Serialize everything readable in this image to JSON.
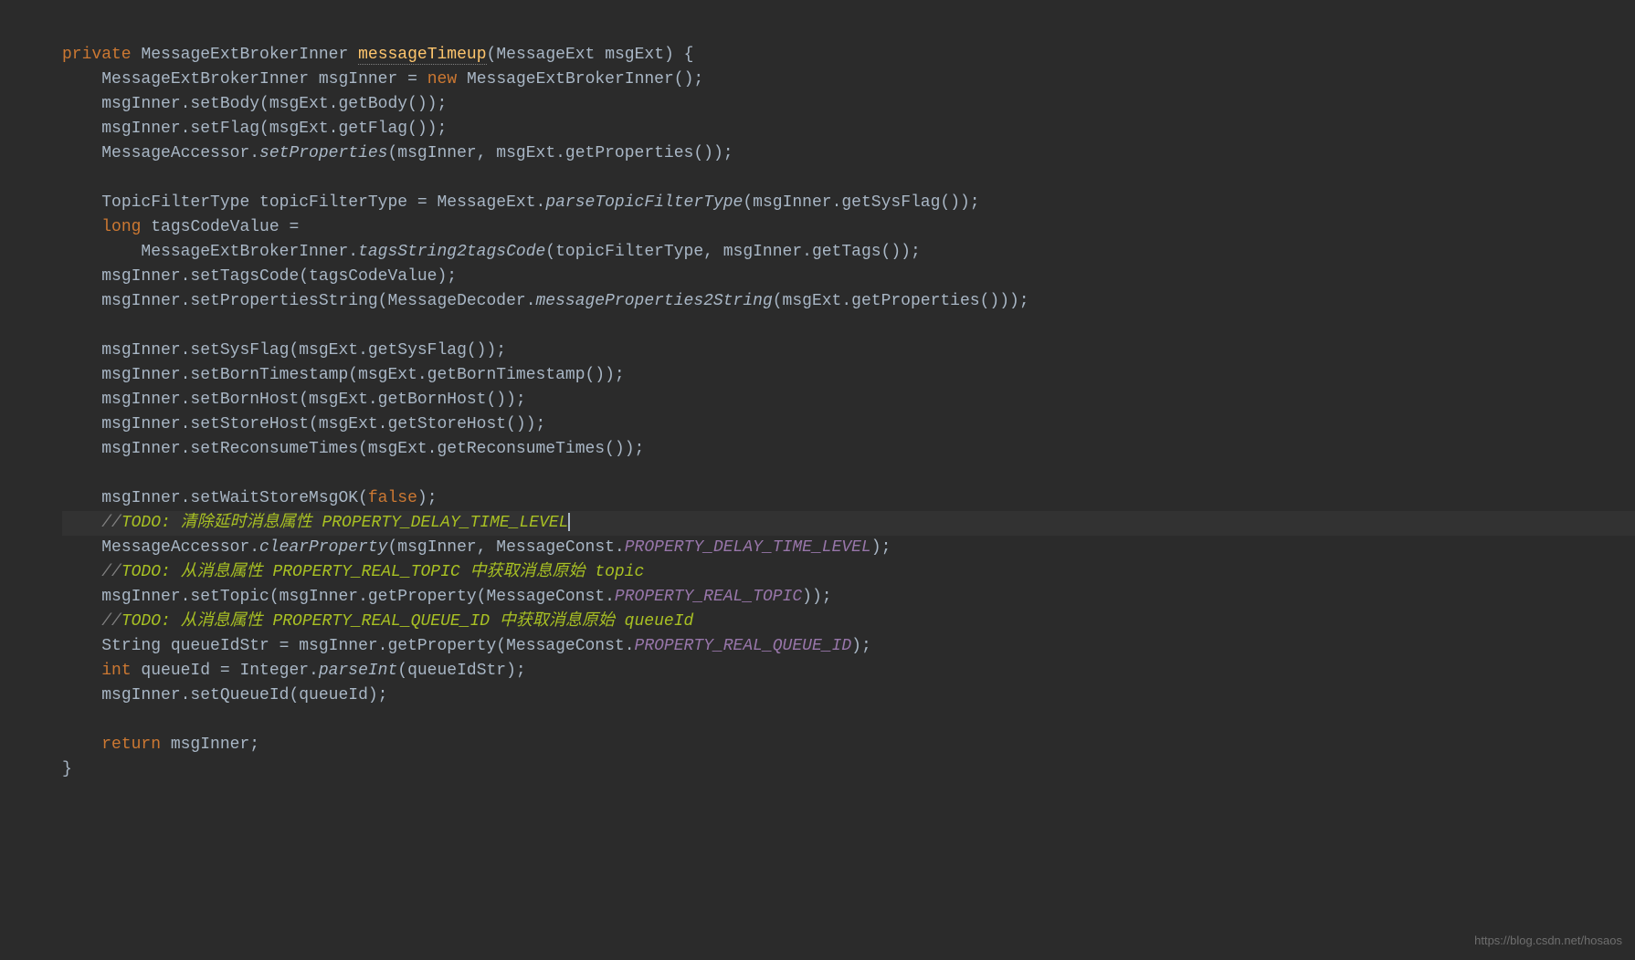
{
  "code": {
    "modifier_private": "private",
    "return_type": "MessageExtBrokerInner",
    "method_name": "messageTimeup",
    "param_type": "MessageExt",
    "param_name": "msgExt",
    "brace_open": "{",
    "brace_close": "}",
    "l1_type": "MessageExtBrokerInner",
    "l1_var": "msgInner",
    "l1_eq": "=",
    "l1_new": "new",
    "l1_ctor": "MessageExtBrokerInner();",
    "l2": "msgInner.setBody(msgExt.getBody());",
    "l3": "msgInner.setFlag(msgExt.getFlag());",
    "l4_a": "MessageAccessor.",
    "l4_m": "setProperties",
    "l4_b": "(msgInner, msgExt.getProperties());",
    "l5_a": "TopicFilterType topicFilterType = MessageExt.",
    "l5_m": "parseTopicFilterType",
    "l5_b": "(msgInner.getSysFlag());",
    "l6_kw": "long",
    "l6_a": " tagsCodeValue =",
    "l7_a": "MessageExtBrokerInner.",
    "l7_m": "tagsString2tagsCode",
    "l7_b": "(topicFilterType, msgInner.getTags());",
    "l8": "msgInner.setTagsCode(tagsCodeValue);",
    "l9_a": "msgInner.setPropertiesString(MessageDecoder.",
    "l9_m": "messageProperties2String",
    "l9_b": "(msgExt.getProperties()));",
    "l10": "msgInner.setSysFlag(msgExt.getSysFlag());",
    "l11": "msgInner.setBornTimestamp(msgExt.getBornTimestamp());",
    "l12": "msgInner.setBornHost(msgExt.getBornHost());",
    "l13": "msgInner.setStoreHost(msgExt.getStoreHost());",
    "l14": "msgInner.setReconsumeTimes(msgExt.getReconsumeTimes());",
    "l15_a": "msgInner.setWaitStoreMsgOK(",
    "l15_false": "false",
    "l15_b": ");",
    "c1_slash": "//",
    "c1_todo": "TODO: 清除延时消息属性 PROPERTY_DELAY_TIME_LEVEL",
    "l16_a": "MessageAccessor.",
    "l16_m": "clearProperty",
    "l16_b": "(msgInner, MessageConst.",
    "l16_const": "PROPERTY_DELAY_TIME_LEVEL",
    "l16_c": ");",
    "c2_slash": "//",
    "c2_todo": "TODO: 从消息属性 PROPERTY_REAL_TOPIC 中获取消息原始 topic",
    "l17_a": "msgInner.setTopic(msgInner.getProperty(MessageConst.",
    "l17_const": "PROPERTY_REAL_TOPIC",
    "l17_b": "));",
    "c3_slash": "//",
    "c3_todo": "TODO: 从消息属性 PROPERTY_REAL_QUEUE_ID 中获取消息原始 queueId",
    "l18_a": "String queueIdStr = msgInner.getProperty(MessageConst.",
    "l18_const": "PROPERTY_REAL_QUEUE_ID",
    "l18_b": ");",
    "l19_kw": "int",
    "l19_a": " queueId = Integer.",
    "l19_m": "parseInt",
    "l19_b": "(queueIdStr);",
    "l20": "msgInner.setQueueId(queueId);",
    "l21_kw": "return",
    "l21_a": " msgInner;"
  },
  "watermark": "https://blog.csdn.net/hosaos"
}
